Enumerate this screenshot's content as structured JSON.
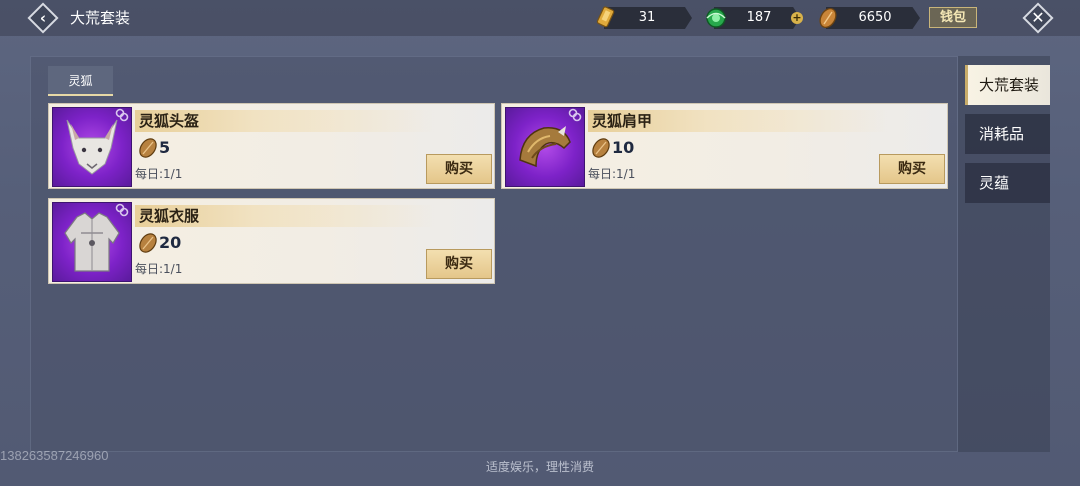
{
  "header": {
    "title": "大荒套装",
    "back_icon": "chevron-left-icon",
    "close_icon": "close-icon"
  },
  "currencies": [
    {
      "name": "golden-scroll-currency",
      "value": "31",
      "color": "#d9a33a"
    },
    {
      "name": "jade-currency",
      "value": "187",
      "color": "#2fbf58"
    },
    {
      "name": "leaf-token-currency",
      "value": "6650",
      "color": "#c7883a"
    }
  ],
  "wallet_label": "钱包",
  "tabs": [
    {
      "label": "灵狐",
      "selected": true
    }
  ],
  "items": [
    {
      "name": "灵狐头盔",
      "cost": "5",
      "daily": "每日:1/1",
      "buy_label": "购买"
    },
    {
      "name": "灵狐肩甲",
      "cost": "10",
      "daily": "每日:1/1",
      "buy_label": "购买"
    },
    {
      "name": "灵狐衣服",
      "cost": "20",
      "daily": "每日:1/1",
      "buy_label": "购买"
    }
  ],
  "sidebar": {
    "items": [
      {
        "label": "大荒套装",
        "active": true
      },
      {
        "label": "消耗品",
        "active": false
      },
      {
        "label": "灵蕴",
        "active": false
      }
    ]
  },
  "footer_note": "适度娱乐，理性消费",
  "watermark": "138263587246960"
}
